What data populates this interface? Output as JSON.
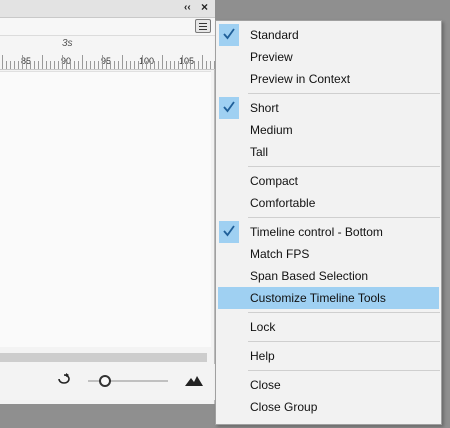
{
  "panel": {
    "collapse_label": "‹‹",
    "close_label": "×",
    "ruler": {
      "seconds_label": "3s",
      "frame_numbers": [
        "85",
        "90",
        "95",
        "100",
        "105"
      ]
    }
  },
  "menu": {
    "accent_color": "#9fd0f2",
    "groups": [
      [
        {
          "label": "Standard",
          "checked": true
        },
        {
          "label": "Preview",
          "checked": false
        },
        {
          "label": "Preview in Context",
          "checked": false
        }
      ],
      [
        {
          "label": "Short",
          "checked": true
        },
        {
          "label": "Medium",
          "checked": false
        },
        {
          "label": "Tall",
          "checked": false
        }
      ],
      [
        {
          "label": "Compact",
          "checked": false
        },
        {
          "label": "Comfortable",
          "checked": false
        }
      ],
      [
        {
          "label": "Timeline control - Bottom",
          "checked": true
        },
        {
          "label": "Match FPS",
          "checked": false
        },
        {
          "label": "Span Based Selection",
          "checked": false
        },
        {
          "label": "Customize Timeline Tools",
          "checked": false,
          "highlighted": true
        }
      ],
      [
        {
          "label": "Lock",
          "checked": false
        }
      ],
      [
        {
          "label": "Help",
          "checked": false
        }
      ],
      [
        {
          "label": "Close",
          "checked": false
        },
        {
          "label": "Close Group",
          "checked": false
        }
      ]
    ]
  }
}
